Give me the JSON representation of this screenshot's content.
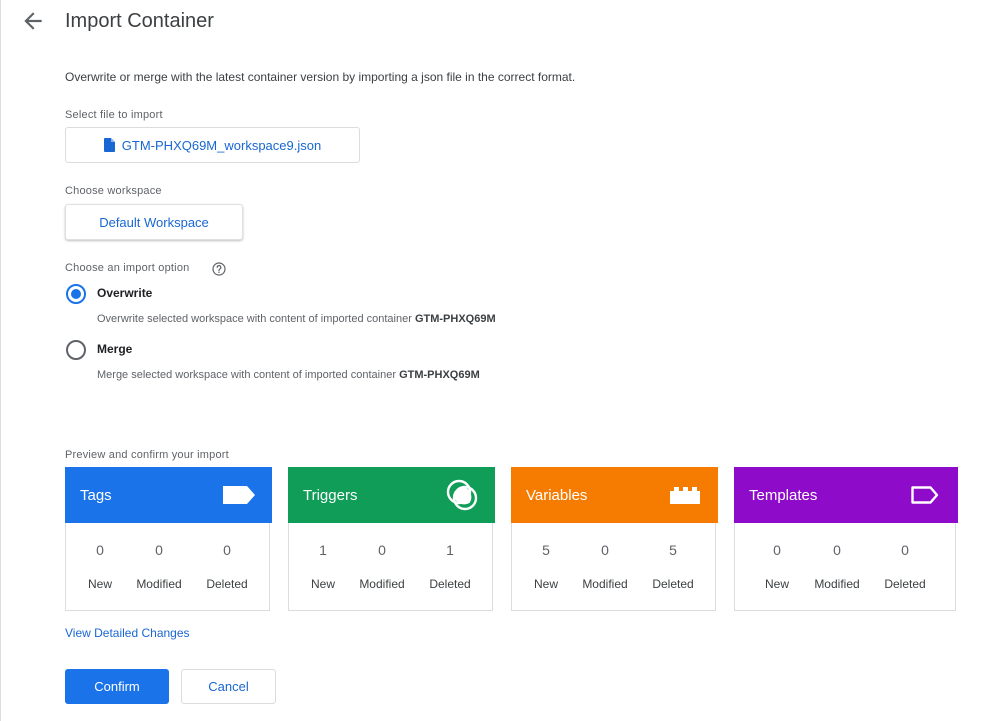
{
  "header": {
    "title": "Import Container",
    "back_icon": "arrow-back-icon"
  },
  "description": "Overwrite or merge with the latest container version by importing a json file in the correct format.",
  "file": {
    "label": "Select file to import",
    "filename": "GTM-PHXQ69M_workspace9.json",
    "icon": "file-icon"
  },
  "workspace": {
    "label": "Choose workspace",
    "value": "Default Workspace"
  },
  "import_option": {
    "label": "Choose an import option",
    "help_icon": "help-icon",
    "options": [
      {
        "label": "Overwrite",
        "selected": true,
        "desc": "Overwrite selected workspace with content of imported container",
        "container": "GTM-PHXQ69M"
      },
      {
        "label": "Merge",
        "selected": false,
        "desc": "Merge selected workspace with content of imported container",
        "container": "GTM-PHXQ69M"
      }
    ]
  },
  "preview": {
    "label": "Preview and confirm your import",
    "stat_labels": [
      "New",
      "Modified",
      "Deleted"
    ],
    "cards": [
      {
        "title": "Tags",
        "color": "#1a73e8",
        "icon": "tag-icon",
        "new": "0",
        "modified": "0",
        "deleted": "0"
      },
      {
        "title": "Triggers",
        "color": "#0f9d58",
        "icon": "trigger-icon",
        "new": "1",
        "modified": "0",
        "deleted": "1"
      },
      {
        "title": "Variables",
        "color": "#f57c00",
        "icon": "variable-icon",
        "new": "5",
        "modified": "0",
        "deleted": "5"
      },
      {
        "title": "Templates",
        "color": "#8e0bc9",
        "icon": "template-icon",
        "new": "0",
        "modified": "0",
        "deleted": "0"
      }
    ]
  },
  "details_link": "View Detailed Changes",
  "actions": {
    "confirm": "Confirm",
    "cancel": "Cancel"
  }
}
